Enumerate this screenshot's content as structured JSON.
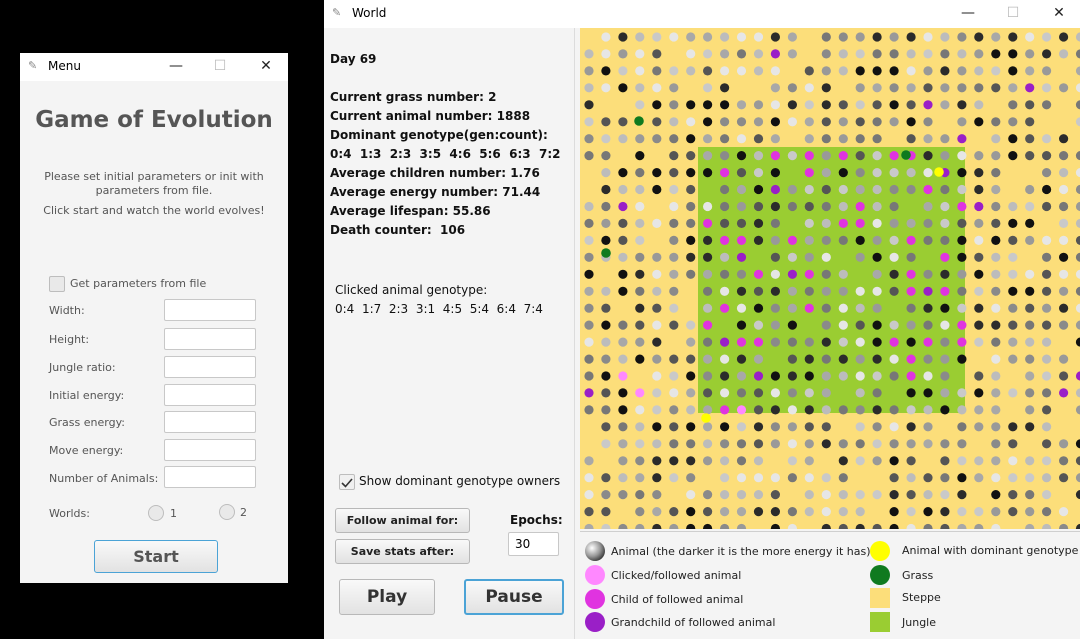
{
  "menu_window": {
    "title": "Menu",
    "minimize": "—",
    "maximize": "☐",
    "close": "✕",
    "heading": "Game of Evolution",
    "description1": "Please set initial parameters or init with parameters from file.",
    "description2": "Click start and watch the world evolves!",
    "file_checkbox_label": "Get parameters from file",
    "fields": [
      {
        "label": "Width:",
        "value": ""
      },
      {
        "label": "Height:",
        "value": ""
      },
      {
        "label": "Jungle ratio:",
        "value": ""
      },
      {
        "label": "Initial energy:",
        "value": ""
      },
      {
        "label": "Grass energy:",
        "value": ""
      },
      {
        "label": "Move energy:",
        "value": ""
      },
      {
        "label": "Number of Animals:",
        "value": ""
      }
    ],
    "worlds_label": "Worlds:",
    "world_options": [
      "1",
      "2"
    ],
    "start_label": "Start"
  },
  "world_window": {
    "title": "World",
    "minimize": "—",
    "maximize": "☐",
    "close": "✕",
    "stats": {
      "day": "Day 69",
      "grass": "Current grass number: 2",
      "animals": "Current animal number: 1888",
      "dominant_title": "Dominant genotype(gen:count):",
      "dominant_values": "0:4  1:3  2:3  3:5  4:6  5:6  6:3  7:2",
      "children": "Average children number: 1.76",
      "energy": "Average energy number: 71.44",
      "lifespan": "Average lifespan: 55.86",
      "deaths": "Death counter:  106"
    },
    "clicked_title": "Clicked animal genotype:",
    "clicked_values": "0:4  1:7  2:3  3:1  4:5  5:4  6:4  7:4",
    "show_dominant_label": "Show dominant genotype owners",
    "follow_label": "Follow animal for:",
    "save_label": "Save stats after:",
    "epochs_label": "Epochs:",
    "epochs_value": "30",
    "play_label": "Play",
    "pause_label": "Pause",
    "legend": [
      {
        "label": "Animal (the darker it is the more energy it has)"
      },
      {
        "label": "Clicked/followed animal"
      },
      {
        "label": "Child of followed animal"
      },
      {
        "label": "Grandchild of followed animal"
      },
      {
        "label": "Animal with dominant genotype"
      },
      {
        "label": "Grass"
      },
      {
        "label": "Steppe"
      },
      {
        "label": "Jungle"
      }
    ],
    "colors": {
      "steppe": "#fcde7a",
      "jungle": "#9acd32",
      "grass": "#0f7a1f",
      "dominant": "#ffff00",
      "clicked": "#ff88ff",
      "child": "#e033e0",
      "grandchild": "#9a1fc7"
    }
  }
}
